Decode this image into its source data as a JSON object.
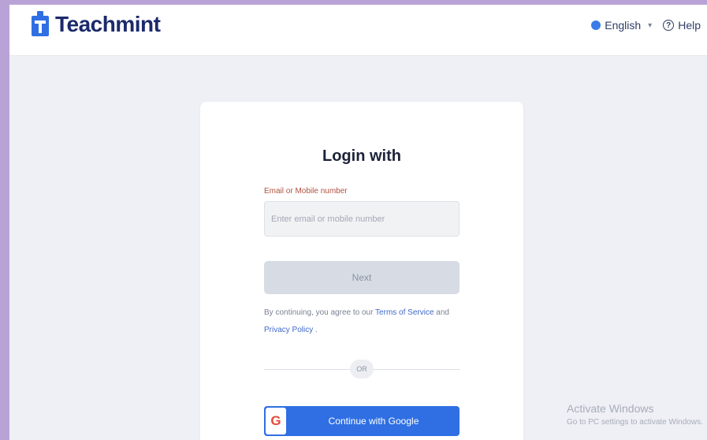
{
  "header": {
    "brand": "Teachmint",
    "language_label": "English",
    "help_label": "Help"
  },
  "login": {
    "title": "Login with",
    "field_label": "Email or Mobile number",
    "input_placeholder": "Enter email or mobile number",
    "input_value": "",
    "next_label": "Next",
    "terms_prefix": "By continuing, you agree to our",
    "terms_link": "Terms of Service",
    "terms_and": "and",
    "privacy_link": "Privacy Policy",
    "terms_suffix": ".",
    "or_label": "OR",
    "google_label": "Continue with Google",
    "google_glyph": "G"
  },
  "watermark": {
    "title": "Activate Windows",
    "subtitle": "Go to PC settings to activate Windows."
  },
  "colors": {
    "brand": "#1c2a6b",
    "google_button": "#2f6fe3",
    "label": "#b0523f",
    "link": "#3f69c9",
    "outer_border": "#b9a3d6"
  },
  "icons": [
    "teachmint-logo-icon",
    "globe-icon",
    "chevron-down-icon",
    "help-icon",
    "google-icon"
  ]
}
